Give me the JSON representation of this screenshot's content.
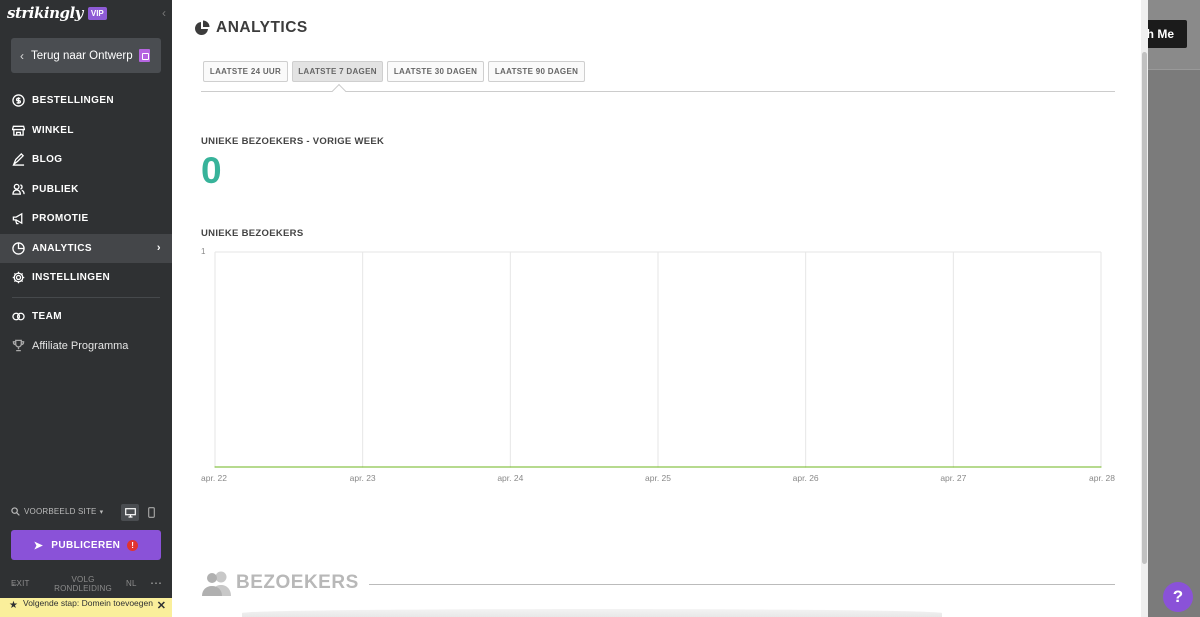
{
  "sidebar": {
    "logo": "strikingly",
    "badge": "VIP",
    "back_label": "Terug naar Ontwerp",
    "items": [
      {
        "label": "BESTELLINGEN",
        "icon": "dollar-icon"
      },
      {
        "label": "WINKEL",
        "icon": "store-icon"
      },
      {
        "label": "BLOG",
        "icon": "pen-icon"
      },
      {
        "label": "PUBLIEK",
        "icon": "people-icon"
      },
      {
        "label": "PROMOTIE",
        "icon": "megaphone-icon"
      },
      {
        "label": "ANALYTICS",
        "icon": "pie-icon",
        "active": true
      },
      {
        "label": "INSTELLINGEN",
        "icon": "gear-icon"
      }
    ],
    "team_label": "TEAM",
    "affiliate_label": "Affiliate Programma",
    "preview_label": "VOORBEELD SITE",
    "publish_label": "PUBLICEREN",
    "publish_alert": "!",
    "exit_label": "EXIT",
    "tour_label": "VOLG RONDLEIDING",
    "lang_label": "NL",
    "next_step": "Volgende stap: Domein toevoegen"
  },
  "main": {
    "title": "ANALYTICS",
    "tabs": [
      "LAATSTE 24 UUR",
      "LAATSTE 7 DAGEN",
      "LAATSTE 30 DAGEN",
      "LAATSTE 90 DAGEN"
    ],
    "active_tab": 1,
    "kpi_title": "UNIEKE BEZOEKERS - VORIGE WEEK",
    "kpi_value": "0",
    "chart_title": "UNIEKE BEZOEKERS",
    "section_title": "BEZOEKERS"
  },
  "chart_data": {
    "type": "line",
    "title": "UNIEKE BEZOEKERS",
    "x": [
      "apr. 22",
      "apr. 23",
      "apr. 24",
      "apr. 25",
      "apr. 26",
      "apr. 27",
      "apr. 28"
    ],
    "series": [
      {
        "values": [
          0,
          0,
          0,
          0,
          0,
          0,
          0
        ],
        "color": "#8bc34a"
      }
    ],
    "ylim": [
      0,
      1
    ],
    "yticks": [
      "1"
    ],
    "grid": true
  },
  "right": {
    "button_label": "th Me",
    "help_label": "?"
  },
  "colors": {
    "accent": "#8a52d8",
    "kpi": "#37b39a",
    "sidebar_bg": "#2f3133",
    "line": "#8bc34a"
  }
}
